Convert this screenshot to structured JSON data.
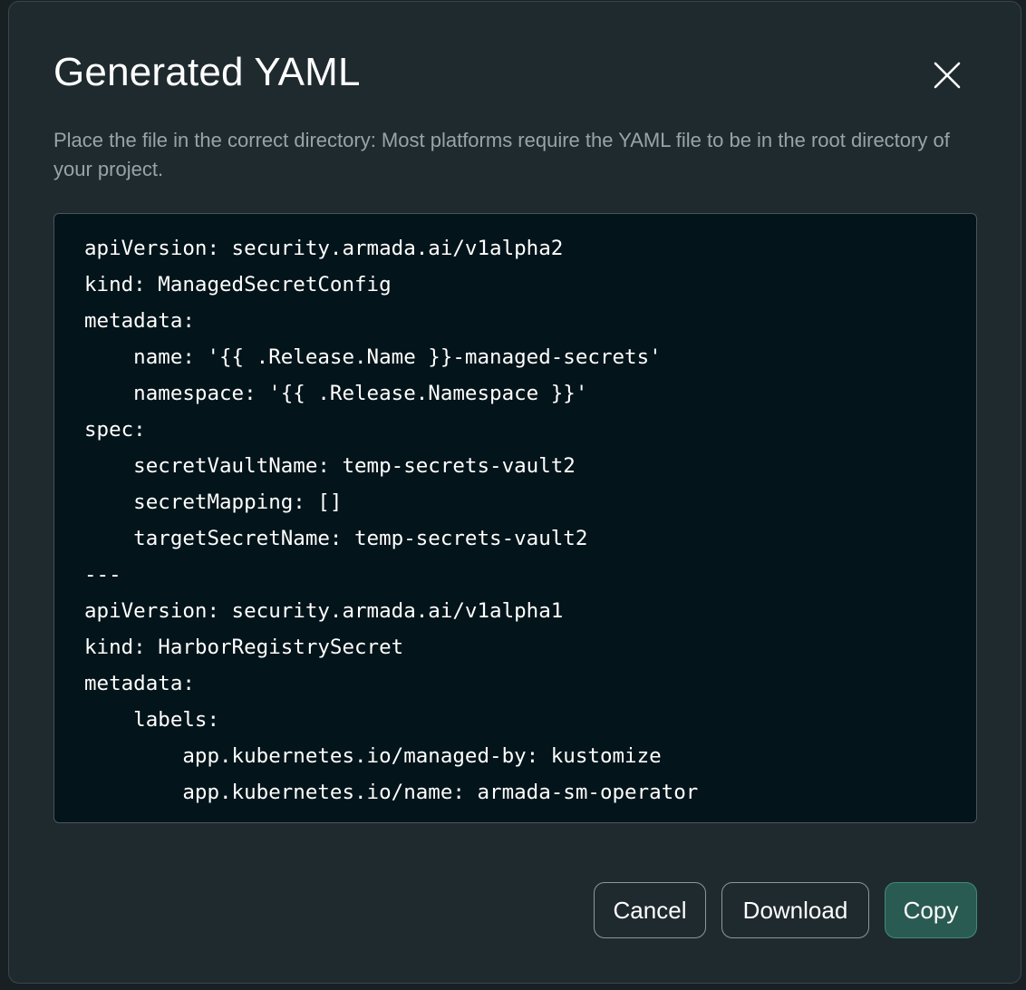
{
  "dialog": {
    "title": "Generated YAML",
    "description": "Place the file in the correct directory: Most platforms require the YAML file to be in the root directory of your project.",
    "close_icon": "close-icon",
    "yaml_lines": [
      "apiVersion: security.armada.ai/v1alpha2",
      "kind: ManagedSecretConfig",
      "metadata:",
      "    name: '{{ .Release.Name }}-managed-secrets'",
      "    namespace: '{{ .Release.Namespace }}'",
      "spec:",
      "    secretVaultName: temp-secrets-vault2",
      "    secretMapping: []",
      "    targetSecretName: temp-secrets-vault2",
      "---",
      "apiVersion: security.armada.ai/v1alpha1",
      "kind: HarborRegistrySecret",
      "metadata:",
      "    labels:",
      "        app.kubernetes.io/managed-by: kustomize",
      "        app.kubernetes.io/name: armada-sm-operator"
    ],
    "buttons": {
      "cancel": "Cancel",
      "download": "Download",
      "copy": "Copy"
    }
  },
  "colors": {
    "modal_background": "#1f2a2f",
    "code_background": "#03141a",
    "primary_button": "#2a5b52",
    "primary_button_border": "#3f8a7d",
    "description_text": "#9aa3a7"
  }
}
